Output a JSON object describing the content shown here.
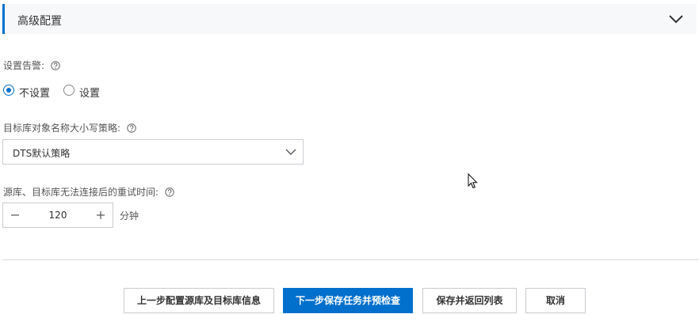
{
  "section": {
    "title": "高级配置",
    "expanded": true
  },
  "alert": {
    "label": "设置告警:",
    "options": [
      {
        "label": "不设置",
        "checked": true
      },
      {
        "label": "设置",
        "checked": false
      }
    ]
  },
  "case_policy": {
    "label": "目标库对象名称大小写策略:",
    "value": "DTS默认策略"
  },
  "retry": {
    "label": "源库、目标库无法连接后的重试时间:",
    "value": "120",
    "unit": "分钟"
  },
  "footer": {
    "prev_label": "上一步配置源库及目标库信息",
    "next_label": "下一步保存任务并预检查",
    "save_label": "保存并返回列表",
    "cancel_label": "取消"
  },
  "colors": {
    "accent": "#0070cc",
    "header_bg": "#f7f8fa"
  }
}
